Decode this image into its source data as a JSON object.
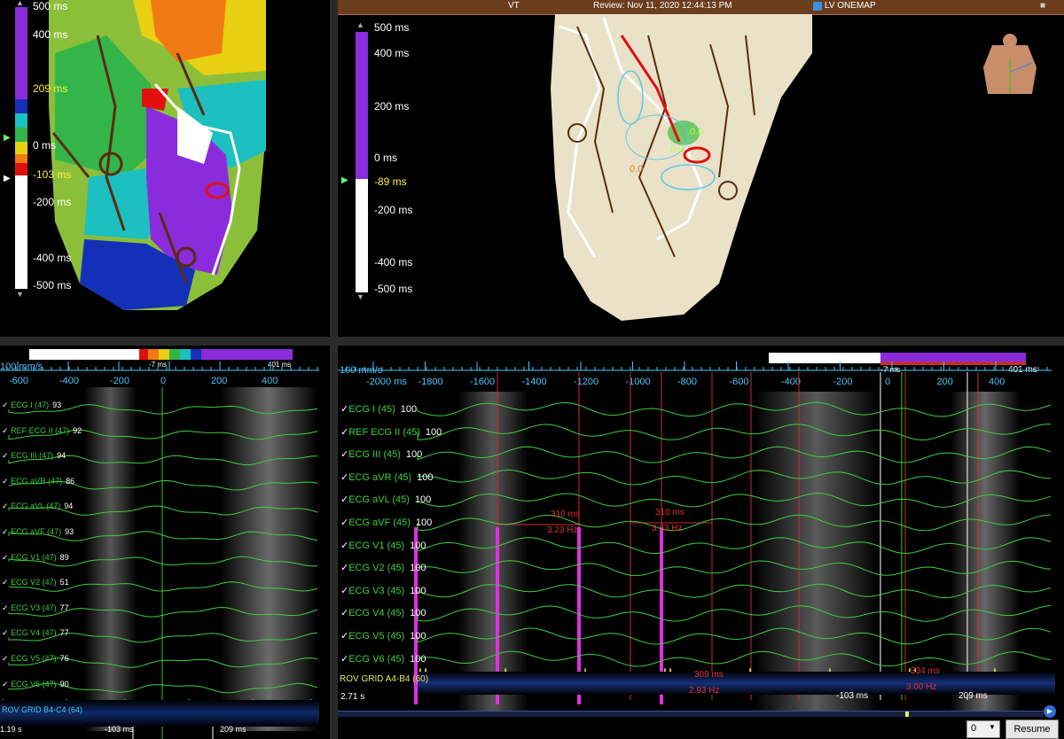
{
  "header": {
    "left": "VT",
    "center": "Review: Nov 11, 2020 12:44:13 PM",
    "right": "LV ONEMAP"
  },
  "left_scale": {
    "labels": [
      "500 ms",
      "400 ms",
      "209 ms",
      "0 ms",
      "-103 ms",
      "-200 ms",
      "-400 ms",
      "-500 ms"
    ]
  },
  "right_scale": {
    "labels": [
      "500 ms",
      "400 ms",
      "200 ms",
      "0 ms",
      "-89 ms",
      "-200 ms",
      "-400 ms",
      "-500 ms"
    ]
  },
  "map_labels": [
    "0.0",
    "0.0",
    "0.0"
  ],
  "left_timeline": {
    "speed": "100 mm/s",
    "ticks": [
      "-600",
      "-400",
      "-200",
      "0",
      "200",
      "400"
    ],
    "window_start": "-7 ms",
    "window_end": "401 ms",
    "channels": [
      {
        "name": "ECG I (47)",
        "value": "93"
      },
      {
        "name": "REF ECG II (47)",
        "value": "92"
      },
      {
        "name": "ECG III (47)",
        "value": "94"
      },
      {
        "name": "ECG aVR (47)",
        "value": "86"
      },
      {
        "name": "ECG aVL (47)",
        "value": "94"
      },
      {
        "name": "ECG aVF (47)",
        "value": "93"
      },
      {
        "name": "ECG V1 (47)",
        "value": "89"
      },
      {
        "name": "ECG V2 (47)",
        "value": "51"
      },
      {
        "name": "ECG V3 (47)",
        "value": "77"
      },
      {
        "name": "ECG V4 (47)",
        "value": "77"
      },
      {
        "name": "ECG V5 (47)",
        "value": "76"
      },
      {
        "name": "ECG V6 (47)",
        "value": "90"
      }
    ],
    "rov_label": "ROV GRID   B4-C4 (64)",
    "time": "1.19 s",
    "marker_left": "-103 ms",
    "marker_right": "209 ms"
  },
  "right_timeline": {
    "speed": "100 mm/s",
    "ticks": [
      "-2000 ms",
      "-1800",
      "-1600",
      "-1400",
      "-1200",
      "-1000",
      "-800",
      "-600",
      "-400",
      "-200",
      "0",
      "200",
      "400"
    ],
    "window_start": "-7 ms",
    "window_end": "401 ms",
    "channels": [
      {
        "name": "ECG I (45)",
        "value": "100"
      },
      {
        "name": "REF ECG II (45)",
        "value": "100"
      },
      {
        "name": "ECG III (45)",
        "value": "100"
      },
      {
        "name": "ECG aVR (45)",
        "value": "100"
      },
      {
        "name": "ECG aVL (45)",
        "value": "100"
      },
      {
        "name": "ECG aVF (45)",
        "value": "100"
      },
      {
        "name": "ECG V1 (45)",
        "value": "100"
      },
      {
        "name": "ECG V2 (45)",
        "value": "100"
      },
      {
        "name": "ECG V3 (45)",
        "value": "100"
      },
      {
        "name": "ECG V4 (45)",
        "value": "100"
      },
      {
        "name": "ECG V5 (45)",
        "value": "100"
      },
      {
        "name": "ECG V6 (45)",
        "value": "100"
      }
    ],
    "rov_label": "ROV GRID   A4-B4 (60)",
    "time": "2.71 s",
    "measurements": [
      {
        "ms": "310 ms",
        "hz": "3.23 Hz"
      },
      {
        "ms": "310 ms",
        "hz": "3.23 Hz"
      },
      {
        "ms": "309 ms",
        "hz": "2.93 Hz"
      },
      {
        "ms": "334 ms",
        "hz": "3.00 Hz"
      }
    ],
    "marker_left": "-103 ms",
    "marker_right": "209 ms"
  },
  "controls": {
    "select_value": "0",
    "resume_label": "Resume"
  }
}
